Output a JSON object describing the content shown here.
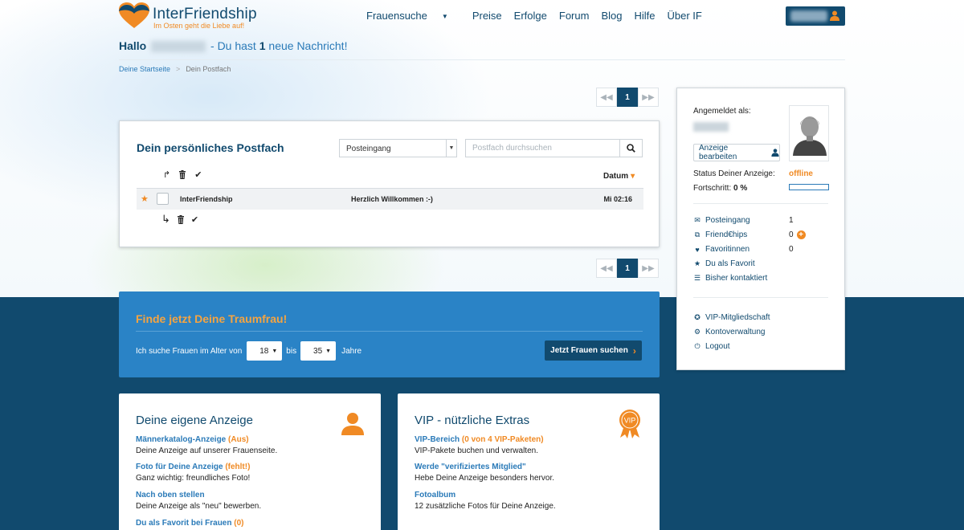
{
  "brand": {
    "name": "InterFriendship",
    "tagline": "Im Osten geht die Liebe auf!",
    "color_primary": "#114a6e",
    "color_accent": "#f08a24",
    "color_blue": "#2a83c6"
  },
  "nav": {
    "items": [
      "Frauensuche",
      "Preise",
      "Erfolge",
      "Forum",
      "Blog",
      "Hilfe",
      "Über IF"
    ]
  },
  "greeting": {
    "hallo": "Hallo",
    "text_before": "- Du hast",
    "count": "1",
    "text_after": "neue Nachricht!"
  },
  "breadcrumb": {
    "home": "Deine Startseite",
    "separator": ">",
    "current": "Dein Postfach"
  },
  "pager": {
    "first_icon": "double-chevron-left-icon",
    "last_icon": "double-chevron-right-icon",
    "current_page": "1"
  },
  "postfach": {
    "title": "Dein persönliches Postfach",
    "folder_selected": "Posteingang",
    "search_placeholder": "Postfach durchsuchen",
    "column_date": "Datum",
    "messages": [
      {
        "from": "InterFriendship",
        "subject": "Herzlich Willkommen :-)",
        "date": "Mi 02:16",
        "starred": true
      }
    ]
  },
  "sidebar": {
    "logged_in_label": "Angemeldet als:",
    "edit_button": "Anzeige bearbeiten",
    "status_label": "Status Deiner Anzeige:",
    "status_value": "offline",
    "progress_label": "Fortschritt:",
    "progress_value": "0 %",
    "progress_fraction": 0,
    "stats": [
      {
        "label": "Posteingang",
        "value": "1",
        "icon": "envelope-icon"
      },
      {
        "label": "Friend€hips",
        "value": "0",
        "icon": "friendships-icon"
      },
      {
        "label": "Favoritinnen",
        "value": "0",
        "icon": "heart-icon"
      },
      {
        "label": "Du als Favorit",
        "value": "",
        "icon": "star-icon"
      },
      {
        "label": "Bisher kontaktiert",
        "value": "",
        "icon": "list-icon"
      }
    ],
    "links": [
      {
        "label": "VIP-Mitgliedschaft",
        "icon": "vip-award-icon"
      },
      {
        "label": "Kontoverwaltung",
        "icon": "gear-icon"
      },
      {
        "label": "Logout",
        "icon": "power-icon"
      }
    ]
  },
  "finder": {
    "title": "Finde jetzt Deine Traumfrau!",
    "prefix": "Ich suche Frauen im Alter von",
    "age_from": "18",
    "between": "bis",
    "age_to": "35",
    "suffix": "Jahre",
    "button": "Jetzt Frauen suchen"
  },
  "cards": {
    "anzeige": {
      "title": "Deine eigene Anzeige",
      "items": [
        {
          "link": "Männerkatalog-Anzeige",
          "status": "(Aus)",
          "desc": "Deine Anzeige auf unserer Frauenseite."
        },
        {
          "link": "Foto für Deine Anzeige",
          "status": "(fehlt!)",
          "desc": "Ganz wichtig: freundliches Foto!"
        },
        {
          "link": "Nach oben stellen",
          "status": "",
          "desc": "Deine Anzeige als \"neu\" bewerben."
        },
        {
          "link": "Du als Favorit bei Frauen",
          "status": "(0)",
          "desc": ""
        }
      ]
    },
    "vip": {
      "title": "VIP - nützliche Extras",
      "badge": "VIP",
      "items": [
        {
          "link": "VIP-Bereich",
          "status": "(0 von 4 VIP-Paketen)",
          "desc": "VIP-Pakete buchen und verwalten."
        },
        {
          "link": "Werde \"verifiziertes Mitglied\"",
          "status": "",
          "desc": "Hebe Deine Anzeige besonders hervor."
        },
        {
          "link": "Fotoalbum",
          "status": "",
          "desc": "12 zusätzliche Fotos für Deine Anzeige."
        }
      ]
    }
  }
}
